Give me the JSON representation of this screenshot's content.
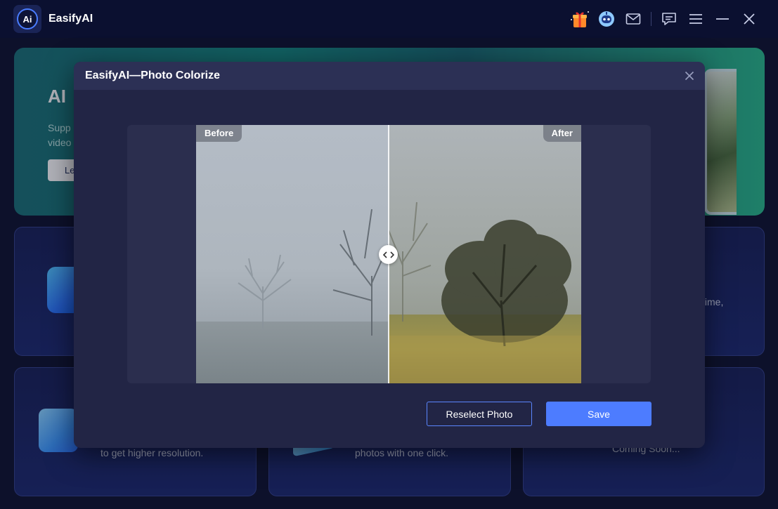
{
  "app": {
    "title": "EasifyAI",
    "logo_text": "Ai"
  },
  "titlebar": {
    "icons": [
      "gift-icon",
      "robot-icon",
      "mail-icon",
      "feedback-icon",
      "menu-icon",
      "minimize-icon",
      "close-icon"
    ]
  },
  "background": {
    "hero": {
      "title": "AI",
      "desc_line1": "Supp",
      "desc_line2": "video",
      "button": "Le"
    },
    "cards": {
      "right_top_text": "time,",
      "left_bottom_text": "to get higher resolution.",
      "mid_bottom_text": "photos with one click.",
      "right_bottom_text": "Coming Soon..."
    }
  },
  "modal": {
    "title": "EasifyAI—Photo Colorize",
    "before_label": "Before",
    "after_label": "After",
    "reselect_label": "Reselect Photo",
    "save_label": "Save"
  },
  "colors": {
    "accent": "#4d7cff",
    "modal_bg": "#222545",
    "header_bg": "#2c3055"
  }
}
